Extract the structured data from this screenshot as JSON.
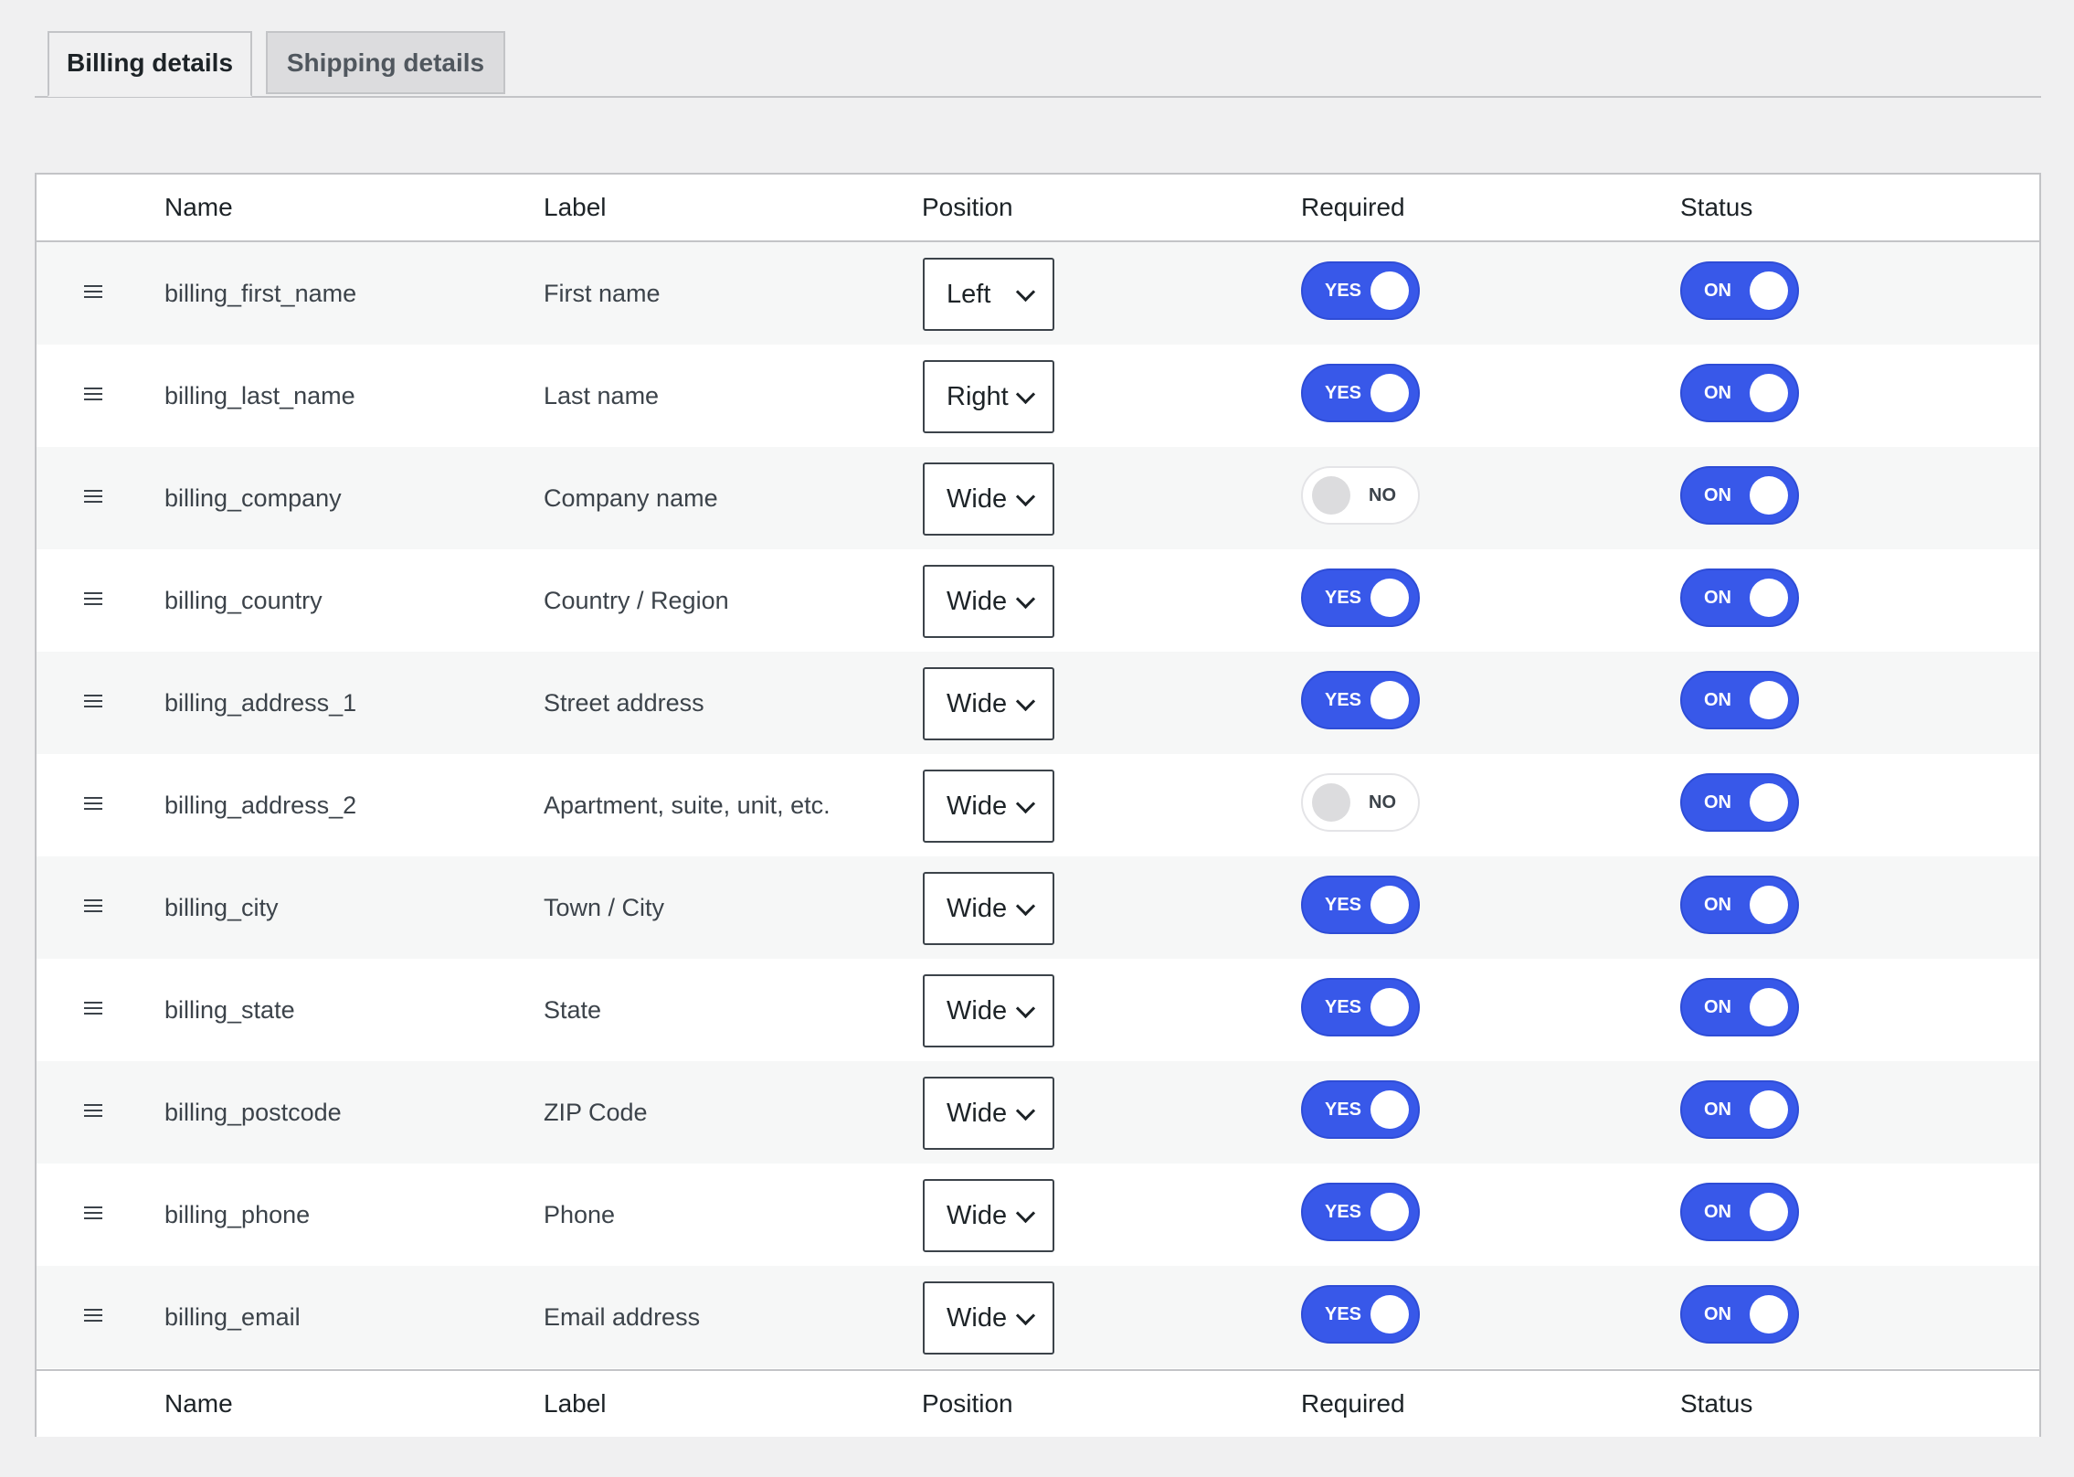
{
  "tabs": [
    {
      "label": "Billing details",
      "active": true
    },
    {
      "label": "Shipping details",
      "active": false
    }
  ],
  "columns": {
    "name": "Name",
    "label": "Label",
    "position": "Position",
    "required": "Required",
    "status": "Status"
  },
  "rows": [
    {
      "name": "billing_first_name",
      "label": "First name",
      "position": "Left",
      "required": "YES",
      "status": "ON"
    },
    {
      "name": "billing_last_name",
      "label": "Last name",
      "position": "Right",
      "required": "YES",
      "status": "ON"
    },
    {
      "name": "billing_company",
      "label": "Company name",
      "position": "Wide",
      "required": "NO",
      "status": "ON"
    },
    {
      "name": "billing_country",
      "label": "Country / Region",
      "position": "Wide",
      "required": "YES",
      "status": "ON"
    },
    {
      "name": "billing_address_1",
      "label": "Street address",
      "position": "Wide",
      "required": "YES",
      "status": "ON"
    },
    {
      "name": "billing_address_2",
      "label": "Apartment, suite, unit, etc.",
      "position": "Wide",
      "required": "NO",
      "status": "ON"
    },
    {
      "name": "billing_city",
      "label": "Town / City",
      "position": "Wide",
      "required": "YES",
      "status": "ON"
    },
    {
      "name": "billing_state",
      "label": "State",
      "position": "Wide",
      "required": "YES",
      "status": "ON"
    },
    {
      "name": "billing_postcode",
      "label": "ZIP Code",
      "position": "Wide",
      "required": "YES",
      "status": "ON"
    },
    {
      "name": "billing_phone",
      "label": "Phone",
      "position": "Wide",
      "required": "YES",
      "status": "ON"
    },
    {
      "name": "billing_email",
      "label": "Email address",
      "position": "Wide",
      "required": "YES",
      "status": "ON"
    }
  ],
  "icons": {
    "drag": "drag-handle-icon",
    "select_arrow": "chevron-down-icon"
  },
  "colors": {
    "toggle_on": "#3858e9",
    "toggle_off": "#ffffff",
    "background": "#f0f0f1"
  }
}
